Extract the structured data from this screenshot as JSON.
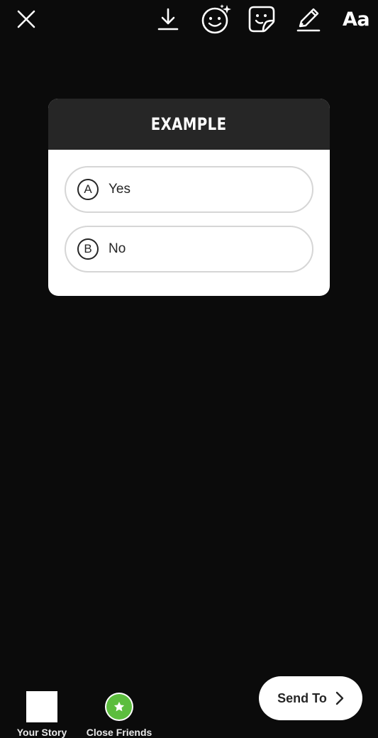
{
  "toolbar": {
    "close_icon": "close-icon",
    "download_icon": "download-icon",
    "effects_icon": "face-effects-icon",
    "sticker_icon": "sticker-icon",
    "draw_icon": "pen-icon",
    "text_label": "Aa"
  },
  "quiz": {
    "title": "EXAMPLE",
    "options": [
      {
        "letter": "A",
        "text": "Yes"
      },
      {
        "letter": "B",
        "text": "No"
      }
    ]
  },
  "bottom": {
    "your_story_label": "Your Story",
    "close_friends_label": "Close Friends",
    "close_friends_color": "#5cbd3e",
    "send_label": "Send To"
  },
  "colors": {
    "background": "#0b0b0b",
    "card_header": "#262626",
    "card_body": "#ffffff"
  }
}
